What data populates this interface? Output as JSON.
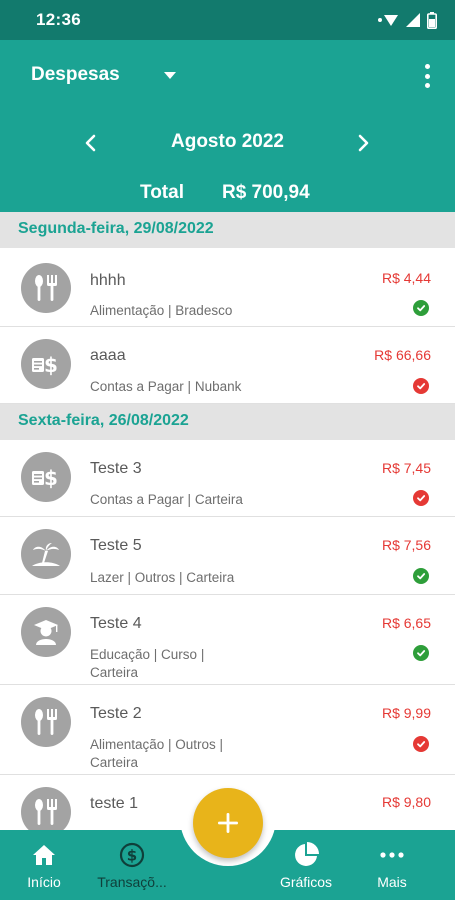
{
  "status_bar": {
    "time": "12:36"
  },
  "header": {
    "title": "Despesas",
    "month": "Agosto 2022",
    "total_label": "Total",
    "total_value": "R$ 700,94"
  },
  "groups": [
    {
      "date_label": "Segunda-feira, 29/08/2022",
      "items": [
        {
          "icon": "fork-knife-icon",
          "name": "hhhh",
          "subtitle": "Alimentação | Bradesco",
          "amount": "R$ 4,44",
          "status": "paid-check-icon"
        },
        {
          "icon": "bill-money-icon",
          "name": "aaaa",
          "subtitle": "Contas a Pagar | Nubank",
          "amount": "R$ 66,66",
          "status": "pending-check-icon"
        }
      ]
    },
    {
      "date_label": "Sexta-feira, 26/08/2022",
      "items": [
        {
          "icon": "bill-money-icon",
          "name": "Teste 3",
          "subtitle": "Contas a Pagar | Carteira",
          "amount": "R$ 7,45",
          "status": "pending-check-icon"
        },
        {
          "icon": "beach-palm-icon",
          "name": "Teste 5",
          "subtitle": "Lazer | Outros | Carteira",
          "amount": "R$ 7,56",
          "status": "paid-check-icon"
        },
        {
          "icon": "graduate-icon",
          "name": "Teste 4",
          "subtitle": "Educação | Curso |\nCarteira",
          "amount": "R$ 6,65",
          "status": "paid-check-icon"
        },
        {
          "icon": "fork-knife-icon",
          "name": "Teste 2",
          "subtitle": "Alimentação | Outros |\nCarteira",
          "amount": "R$ 9,99",
          "status": "pending-check-icon"
        },
        {
          "icon": "fork-knife-icon",
          "name": "teste 1",
          "subtitle": "",
          "amount": "R$ 9,80",
          "status": ""
        }
      ]
    }
  ],
  "bottom_nav": {
    "home": "Início",
    "transactions": "Transaçõ...",
    "charts": "Gráficos",
    "more": "Mais"
  },
  "fab_icon": "plus-icon",
  "colors": {
    "primary": "#1ba393",
    "status_bar": "#127a6d",
    "expense": "#e53935",
    "paid": "#2e9e3a",
    "fab": "#e8b41a"
  }
}
